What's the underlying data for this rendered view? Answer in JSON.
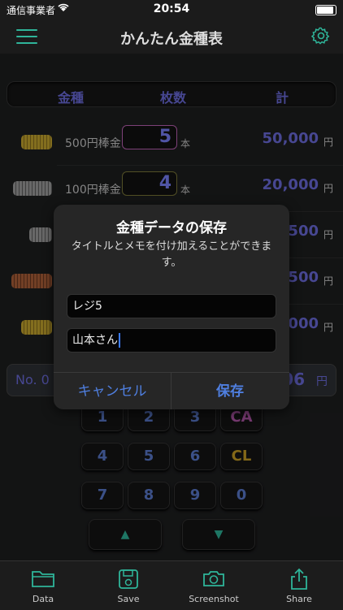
{
  "status": {
    "carrier": "通信事業者",
    "time": "20:54"
  },
  "nav": {
    "title": "かんたん金種表",
    "menu_icon": "hamburger-menu-icon",
    "settings_icon": "gear-icon"
  },
  "header": {
    "col_denomination": "金種",
    "col_count": "枚数",
    "col_total": "計"
  },
  "rows": [
    {
      "label": "500円棒金",
      "count": "5",
      "unit": "本",
      "amount": "50,000",
      "yen": "円",
      "coin_color": "#c9a92e"
    },
    {
      "label": "100円棒金",
      "count": "4",
      "unit": "本",
      "amount": "20,000",
      "yen": "円",
      "coin_color": "#9a9a9a"
    },
    {
      "label": "",
      "count": "",
      "unit": "",
      "amount": "500",
      "yen": "円",
      "coin_color": "#9a9a9a"
    },
    {
      "label": "",
      "count": "",
      "unit": "",
      "amount": "500",
      "yen": "円",
      "coin_color": "#b0623a"
    },
    {
      "label": "",
      "count": "",
      "unit": "",
      "amount": "000",
      "yen": "円",
      "coin_color": "#c9a92e"
    }
  ],
  "total": {
    "no_label": "No. 0",
    "value": "06",
    "yen": "円"
  },
  "keypad": {
    "row1": [
      "1",
      "2",
      "3",
      "CA"
    ],
    "row2": [
      "4",
      "5",
      "6",
      "CL"
    ],
    "row3": [
      "7",
      "8",
      "9",
      "0"
    ],
    "up": "▲",
    "down": "▼"
  },
  "tabs": [
    {
      "label": "Data",
      "icon": "folder-icon"
    },
    {
      "label": "Save",
      "icon": "save-icon"
    },
    {
      "label": "Screenshot",
      "icon": "camera-icon"
    },
    {
      "label": "Share",
      "icon": "share-icon"
    }
  ],
  "dialog": {
    "title": "金種データの保存",
    "message": "タイトルとメモを付け加えることができます。",
    "title_value": "レジ5",
    "memo_value": "山本さん",
    "cancel": "キャンセル",
    "save": "保存"
  },
  "colors": {
    "accent": "#2fb59a",
    "value_blue": "#6d6de0",
    "link_blue": "#4f7fe0"
  }
}
